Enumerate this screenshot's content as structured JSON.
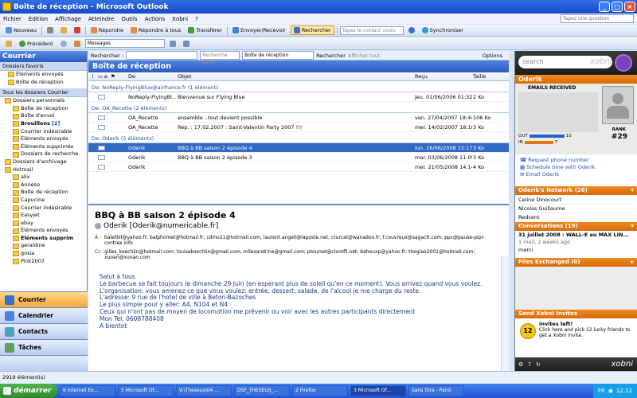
{
  "window": {
    "title": "Boîte de réception - Microsoft Outlook",
    "help_placeholder": "Tapez une question"
  },
  "menu": [
    "Fichier",
    "Edition",
    "Affichage",
    "Atteindre",
    "Outils",
    "Actions",
    "Xobni",
    "?"
  ],
  "toolbar1": {
    "new": "Nouveau",
    "reply": "Répondre",
    "reply_all": "Répondre à tous",
    "forward": "Transférer",
    "send_receive": "Envoyer/Recevoir",
    "find": "Rechercher",
    "contact_placeholder": "Tapez le contact voulu",
    "sync": "Synchroniser"
  },
  "toolbar2": {
    "previous": "Précédent",
    "folder_select": "Messages"
  },
  "nav": {
    "header": "Courrier",
    "favorites_label": "Dossiers favoris",
    "favorites": [
      "Éléments envoyés",
      "Boîte de réception"
    ],
    "all_label": "Tous les dossiers Courrier",
    "folders": [
      {
        "label": "Dossiers personnels",
        "bold": false,
        "indent": 0
      },
      {
        "label": "Boîte de réception",
        "bold": false,
        "indent": 1
      },
      {
        "label": "Boîte d'envoi",
        "bold": false,
        "indent": 1
      },
      {
        "label": "Brouillons",
        "bold": true,
        "indent": 1,
        "count": "[2]"
      },
      {
        "label": "Courrier indésirable",
        "bold": false,
        "indent": 1
      },
      {
        "label": "Éléments envoyés",
        "bold": false,
        "indent": 1
      },
      {
        "label": "Éléments supprimés",
        "bold": false,
        "indent": 1
      },
      {
        "label": "Dossiers de recherche",
        "bold": false,
        "indent": 1
      },
      {
        "label": "Dossiers d'archivage",
        "bold": false,
        "indent": 0
      },
      {
        "label": "Hotmail",
        "bold": false,
        "indent": 0
      },
      {
        "label": "alix",
        "bold": false,
        "indent": 1
      },
      {
        "label": "Anneso",
        "bold": false,
        "indent": 1
      },
      {
        "label": "Boîte de réception",
        "bold": false,
        "indent": 1
      },
      {
        "label": "Capucine",
        "bold": false,
        "indent": 1
      },
      {
        "label": "Courrier indésirable",
        "bold": false,
        "indent": 1
      },
      {
        "label": "Easyjet",
        "bold": false,
        "indent": 1
      },
      {
        "label": "ebay",
        "bold": false,
        "indent": 1
      },
      {
        "label": "Éléments envoyés",
        "bold": false,
        "indent": 1
      },
      {
        "label": "Éléments supprim",
        "bold": true,
        "indent": 1
      },
      {
        "label": "geraldine",
        "bold": false,
        "indent": 1
      },
      {
        "label": "gosia",
        "bold": false,
        "indent": 1
      },
      {
        "label": "Pink2007",
        "bold": false,
        "indent": 1
      }
    ],
    "buttons": [
      "Courrier",
      "Calendrier",
      "Contacts",
      "Tâches"
    ]
  },
  "search": {
    "label": "Rechercher :",
    "scope_placeholder": "Recherche dans",
    "scope_value": "Boîte de réception",
    "button": "Rechercher",
    "show_all": "Afficher tout",
    "options": "Options"
  },
  "inbox": {
    "title": "Boîte de réception",
    "columns": {
      "from": "De",
      "subject": "Objet",
      "received": "Reçu",
      "size": "Taille"
    },
    "groups": [
      {
        "label": "De: NoReply-FlyingBlue@airfrance.fr (1 élément)",
        "rows": [
          {
            "from": "NoReply-FlyingBl...",
            "subject": "Bienvenue sur Flying Blue",
            "received": "jeu. 01/06/2006 01:32",
            "size": "2 Ko",
            "selected": false
          }
        ]
      },
      {
        "label": "De: OA_Recette (2 éléments)",
        "rows": [
          {
            "from": "OA_Recette",
            "subject": "ensemble ..tout devient possible",
            "received": "ven. 27/04/2007 18:44",
            "size": "106 Ko",
            "selected": false
          },
          {
            "from": "OA_Recette",
            "subject": "Rép. : 17.02.2007 : Saint-Valentin Party 2007 !!!",
            "received": "mer. 14/02/2007 18:18",
            "size": "3 Ko",
            "selected": false
          }
        ]
      },
      {
        "label": "De: Oderik (5 éléments)",
        "rows": [
          {
            "from": "Oderik",
            "subject": "BBQ à BB saison 2 épisode 4",
            "received": "lun. 16/06/2008 15:17",
            "size": "3 Ko",
            "selected": true
          },
          {
            "from": "Oderik",
            "subject": "BBQ à BB saison 2 épisode 3",
            "received": "mar. 03/06/2008 11:09",
            "size": "3 Ko",
            "selected": false
          },
          {
            "from": "Oderik",
            "subject": "",
            "received": "mer. 21/05/2008 14:14",
            "size": "4 Ko",
            "selected": false
          }
        ]
      }
    ]
  },
  "reading": {
    "subject": "BBQ à BB saison 2 épisode 4",
    "from": "Oderik [Oderik@numericable.fr]",
    "to_label": "À :",
    "to_1": "baletbil@yahoo.fr; balphomet@hotmail.fr; cdino21@hotmail.com; laurent.angeli@laposte.net; cturcat@wanadoo.fr; f.couvreux@sagactl.com; ppc@pause-pipi-",
    "to_2": "contrex.info",
    "cc_label": "Cc :",
    "cc_1": "gilles_koechlin@hotmail.com; louisekoechlin@gmail.com; mllesandrine@gmail.com; ptoursel@clorofil.net; baheuxp@yahoo.fr; thegiao2001@hotmail.com;",
    "cc_2": "xuoan@xuoan.com",
    "body": "Salut à tous\nLe barbecue se fait toujours le dimanche 29 Juin (en esperant plus de soleil qu'en ce moment). Vous arrivez quand vous voulez.\nL'organisation: vous amenez ce que vous voulez: entrée, dessert, salade, de l'alcool je me charge du reste.\nL'adresse: 9 rue de l'hotel de ville à Beton-Bazoches\nLe plus simple pour y aller: A4, N104 et N4.\nCeux qui n'ont pas de moyen de locomotion me prévenir ou voir avec les autres participants directement\nMon Tel: 0608788408\nA bientot"
  },
  "xobni": {
    "search_placeholder": "search",
    "brand": "xobni",
    "profile_name": "Oderik",
    "emails_received": "EMAILS RECEIVED",
    "out_label": "OUT",
    "out_count": "10",
    "in_label": "IN",
    "in_count": "7",
    "out_fraction": 0.55,
    "in_fraction": 0.45,
    "rank_label": "RANK",
    "rank_value": "#29",
    "actions": [
      "Request phone number",
      "Schedule time with Oderik",
      "Email Oderik"
    ],
    "network_label": "Oderik's Network (26)",
    "network": [
      "Celine Dinocourt",
      "Nicolas Guillaume",
      "Redcent"
    ],
    "conversations_label": "Conversations (19)",
    "conv_title": "31 juillet 2008 : WALL-E au MAX LIN...",
    "conv_meta": "1 mail, 2 weeks ago",
    "conv_next": "merci",
    "files_label": "Files Exchanged (0)",
    "invites_label": "Send Xobni Invites",
    "invites_count": "12",
    "invites_left": "invites left!",
    "invites_text": "Click here and pick 12 lucky friends to get a Xobni invite.",
    "footer_brand": "xobni"
  },
  "status": {
    "items": "2919 élément(s)"
  },
  "taskbar": {
    "start": "démarrer",
    "tasks": [
      "6 Internet Ex...",
      "5 Microsoft Of...",
      "V:\\Theseus\\04 ...",
      "DSF_THESEUS_...",
      "2 Firefox",
      "3 Microsoft Of...",
      "Sans titre - Paint"
    ],
    "active_index": 5,
    "lang": "FR",
    "clock": "12:12"
  },
  "colors": {
    "outlook_blue": "#2a5dc2",
    "xobni_orange": "#e07a10",
    "selection": "#316ac5"
  }
}
